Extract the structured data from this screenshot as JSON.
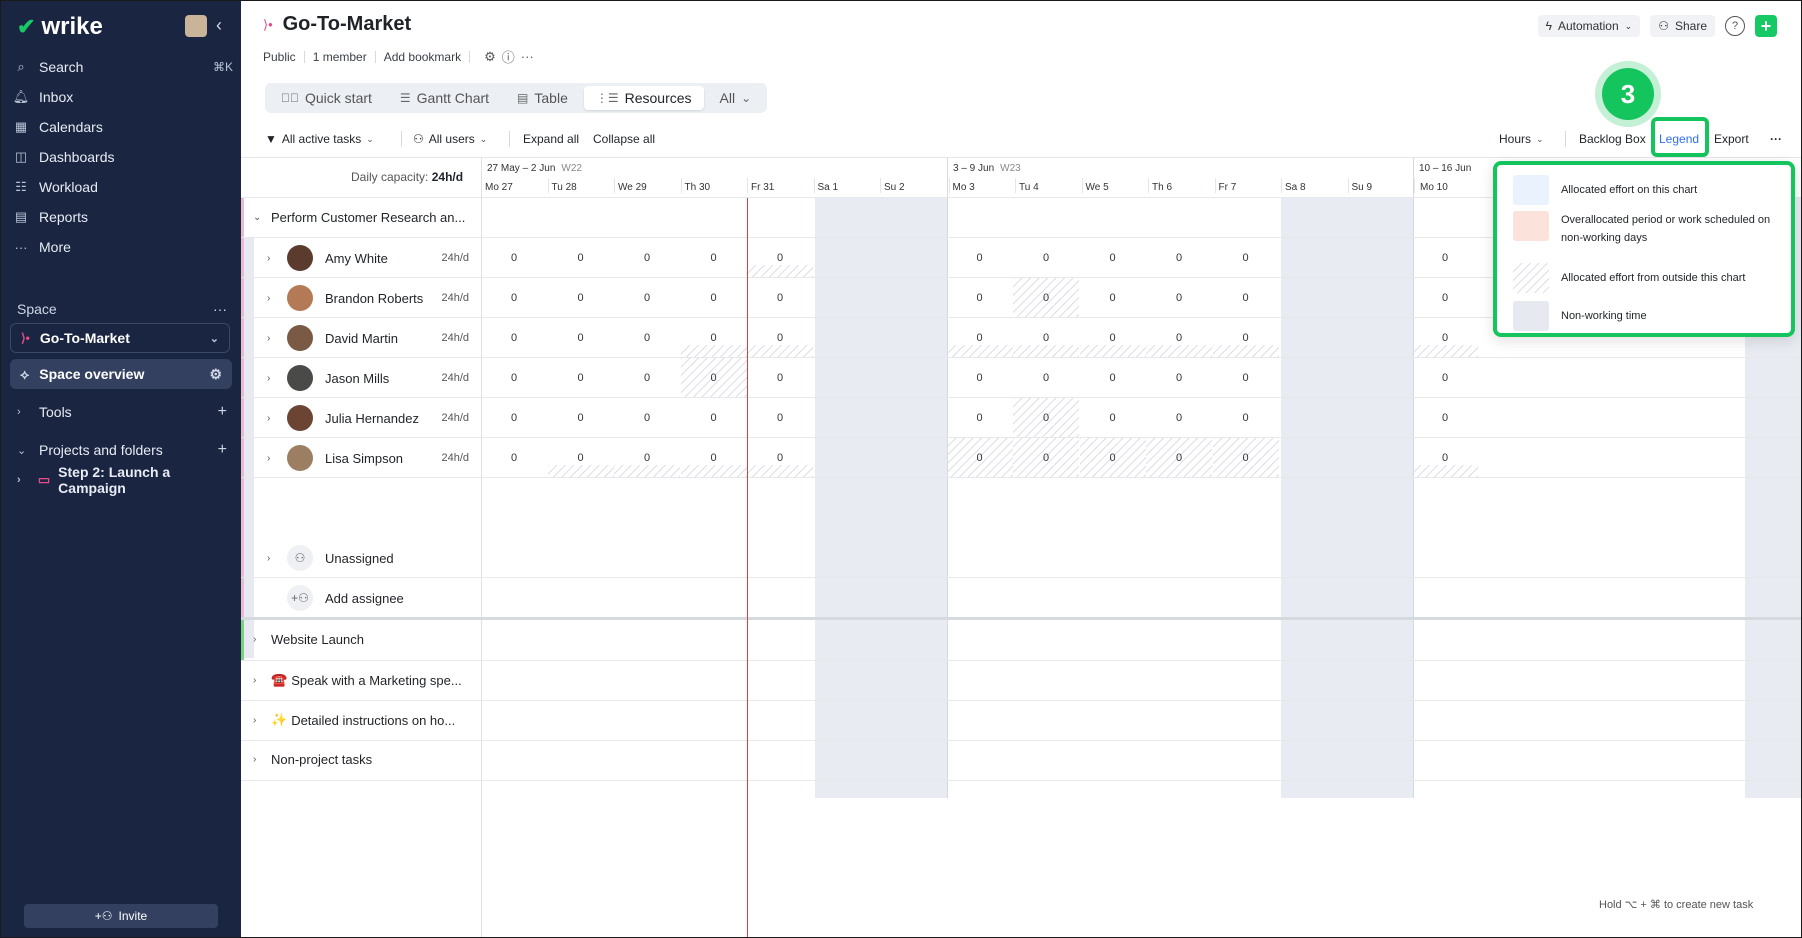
{
  "sidebar": {
    "brand": "wrike",
    "nav": [
      {
        "label": "Search",
        "icon": "search-icon",
        "shortcut": "⌘K"
      },
      {
        "label": "Inbox",
        "icon": "bell-icon"
      },
      {
        "label": "Calendars",
        "icon": "calendar-icon"
      },
      {
        "label": "Dashboards",
        "icon": "dashboard-icon"
      },
      {
        "label": "Workload",
        "icon": "workload-icon"
      },
      {
        "label": "Reports",
        "icon": "report-icon"
      },
      {
        "label": "More",
        "icon": "more-icon"
      }
    ],
    "space_label": "Space",
    "space_name": "Go-To-Market",
    "space_overview": "Space overview",
    "tools": "Tools",
    "projects_and_folders": "Projects and folders",
    "folder": "Step 2: Launch a Campaign",
    "invite": "Invite"
  },
  "header": {
    "title": "Go-To-Market",
    "visibility": "Public",
    "members": "1 member",
    "add_bookmark": "Add bookmark",
    "automation": "Automation",
    "share": "Share",
    "help": "?"
  },
  "tabs": [
    {
      "label": "Quick start",
      "icon": "quickstart-icon"
    },
    {
      "label": "Gantt Chart",
      "icon": "gantt-icon"
    },
    {
      "label": "Table",
      "icon": "table-icon"
    },
    {
      "label": "Resources",
      "icon": "resources-icon",
      "active": true
    },
    {
      "label": "All",
      "icon": "chevron-down-icon"
    }
  ],
  "toolbar": {
    "filter_tasks": "All active tasks",
    "filter_users": "All users",
    "expand_all": "Expand all",
    "collapse_all": "Collapse all",
    "hours": "Hours",
    "backlog_box": "Backlog Box",
    "legend": "Legend",
    "export": "Export"
  },
  "grid": {
    "capacity_label": "Daily capacity:",
    "capacity_value": "24h/d",
    "weeks": [
      {
        "range": "27 May – 2 Jun",
        "num": "W22"
      },
      {
        "range": "3 – 9 Jun",
        "num": "W23"
      },
      {
        "range": "10 – 16 Jun",
        "num": ""
      }
    ],
    "days": [
      "Mo 27",
      "Tu 28",
      "We 29",
      "Th 30",
      "Fr 31",
      "Sa 1",
      "Su 2",
      "Mo 3",
      "Tu 4",
      "We 5",
      "Th 6",
      "Fr 7",
      "Sa 8",
      "Su 9",
      "Mo 10"
    ],
    "project_main": "Perform Customer Research an...",
    "people": [
      {
        "name": "Amy White",
        "capacity": "24h/d",
        "avatar_color": "#5a3b2e"
      },
      {
        "name": "Brandon Roberts",
        "capacity": "24h/d",
        "avatar_color": "#b47a55"
      },
      {
        "name": "David Martin",
        "capacity": "24h/d",
        "avatar_color": "#7a5a44"
      },
      {
        "name": "Jason Mills",
        "capacity": "24h/d",
        "avatar_color": "#4a4a48"
      },
      {
        "name": "Julia Hernandez",
        "capacity": "24h/d",
        "avatar_color": "#6b4434"
      },
      {
        "name": "Lisa Simpson",
        "capacity": "24h/d",
        "avatar_color": "#9c7f63"
      }
    ],
    "unassigned": "Unassigned",
    "add_assignee": "Add assignee",
    "zero": "0",
    "other_projects": [
      {
        "label": "Website Launch",
        "emoji": "",
        "bar_color": "#7ccf83"
      },
      {
        "label": "Speak with a Marketing spe...",
        "emoji": "☎️"
      },
      {
        "label": "Detailed instructions on ho...",
        "emoji": "✨"
      },
      {
        "label": "Non-project tasks",
        "emoji": ""
      }
    ]
  },
  "legend": {
    "items": [
      {
        "text": "Allocated effort on this chart",
        "color": "#eaf2fe"
      },
      {
        "text": "Overallocated period or work scheduled on non-working days",
        "color": "#fbe3dc"
      },
      {
        "text": "Allocated effort from outside this chart",
        "color": "hatch"
      },
      {
        "text": "Non-working time",
        "color": "#e6e9f0"
      }
    ]
  },
  "step_badge": "3",
  "hint": "Hold ⌥ + ⌘ to create new task"
}
